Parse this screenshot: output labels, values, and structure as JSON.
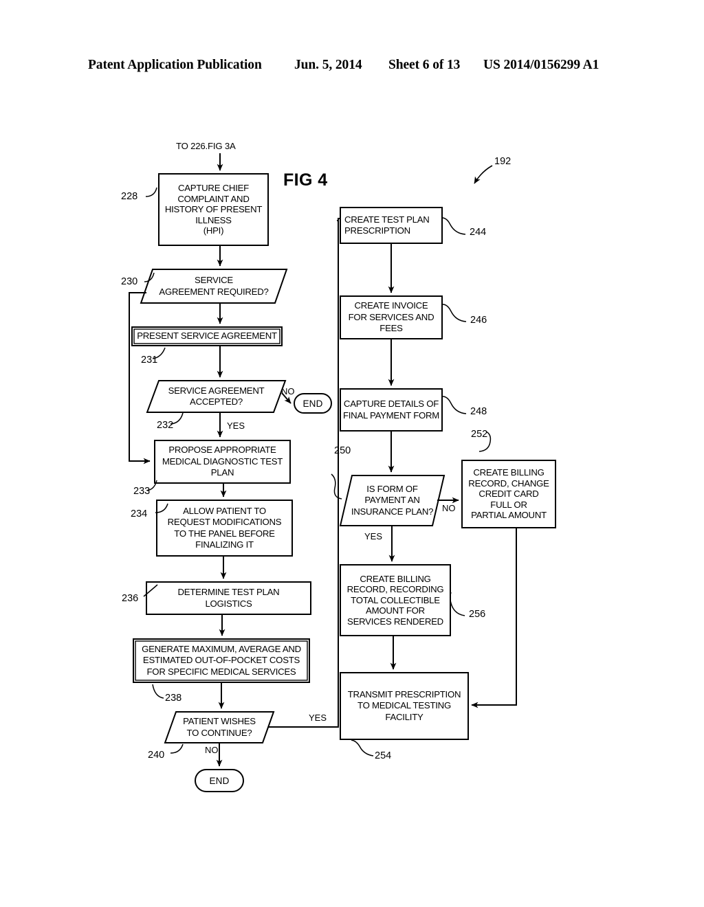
{
  "header": {
    "publication": "Patent Application Publication",
    "date": "Jun. 5, 2014",
    "sheet": "Sheet 6 of 13",
    "patent_number": "US 2014/0156299 A1"
  },
  "figure": {
    "title": "FIG 4",
    "overall_ref": "192",
    "entry_connector": "TO 226.FIG 3A",
    "nodes": {
      "n228": {
        "ref": "228",
        "text": "CAPTURE CHIEF\nCOMPLAINT AND\nHISTORY OF PRESENT\nILLNESS\n(HPI)",
        "shape": "process"
      },
      "n230": {
        "ref": "230",
        "text": "SERVICE\nAGREEMENT REQUIRED?",
        "shape": "decision"
      },
      "n231": {
        "ref": "231",
        "text": "PRESENT SERVICE AGREEMENT",
        "shape": "process"
      },
      "n232": {
        "ref": "232",
        "text": "SERVICE AGREEMENT\nACCEPTED?",
        "shape": "decision"
      },
      "n233": {
        "ref": "233",
        "text": "PROPOSE APPROPRIATE\nMEDICAL DIAGNOSTIC TEST\nPLAN",
        "shape": "process"
      },
      "n234": {
        "ref": "234",
        "text": "ALLOW PATIENT TO\nREQUEST MODIFICATIONS\nTO THE PANEL BEFORE\nFINALIZING IT",
        "shape": "process"
      },
      "n236": {
        "ref": "236",
        "text": "DETERMINE TEST PLAN\nLOGISTICS",
        "shape": "process"
      },
      "n238": {
        "ref": "238",
        "text": "GENERATE MAXIMUM, AVERAGE AND\nESTIMATED OUT-OF-POCKET COSTS\nFOR SPECIFIC MEDICAL SERVICES",
        "shape": "process"
      },
      "n240": {
        "ref": "240",
        "text": "PATIENT WISHES\nTO CONTINUE?",
        "shape": "decision"
      },
      "n244": {
        "ref": "244",
        "text": "CREATE TEST PLAN\nPRESCRIPTION",
        "shape": "process"
      },
      "n246": {
        "ref": "246",
        "text": "CREATE INVOICE\nFOR SERVICES AND\nFEES",
        "shape": "process"
      },
      "n248": {
        "ref": "248",
        "text": "CAPTURE DETAILS OF\nFINAL PAYMENT FORM",
        "shape": "process"
      },
      "n250": {
        "ref": "250",
        "text": "IS FORM OF\nPAYMENT AN\nINSURANCE PLAN?",
        "shape": "decision"
      },
      "n252": {
        "ref": "252",
        "text": "CREATE BILLING\nRECORD, CHANGE\nCREDIT CARD\nFULL OR\nPARTIAL AMOUNT",
        "shape": "process"
      },
      "n254": {
        "ref": "254",
        "text": "TRANSMIT PRESCRIPTION\nTO MEDICAL TESTING\nFACILITY",
        "shape": "process"
      },
      "n256": {
        "ref": "256",
        "text": "CREATE BILLING\nRECORD, RECORDING\nTOTAL COLLECTIBLE\nAMOUNT FOR\nSERVICES RENDERED",
        "shape": "process"
      },
      "end_top": {
        "text": "END",
        "shape": "terminator"
      },
      "end_bottom": {
        "text": "END",
        "shape": "terminator"
      }
    },
    "edge_labels": {
      "e232_no": "NO",
      "e232_yes": "YES",
      "e240_no": "NO",
      "e240_yes": "YES",
      "e250_no": "NO",
      "e250_yes": "YES"
    }
  }
}
